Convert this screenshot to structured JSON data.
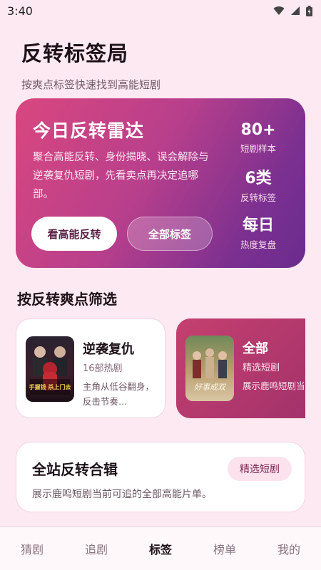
{
  "status_bar": {
    "time": "3:40"
  },
  "header": {
    "title": "反转标签局",
    "subtitle": "按爽点标签快速找到高能短剧"
  },
  "hero": {
    "title": "今日反转雷达",
    "description": "聚合高能反转、身份揭晓、误会解除与逆袭复仇短剧，先看卖点再决定追哪部。",
    "primary_button": "看高能反转",
    "secondary_button": "全部标签",
    "stats": [
      {
        "value": "80+",
        "label": "短剧样本"
      },
      {
        "value": "6类",
        "label": "反转标签"
      },
      {
        "value": "每日",
        "label": "热度复盘"
      }
    ]
  },
  "filter_section": {
    "title": "按反转爽点筛选"
  },
  "categories": [
    {
      "name": "逆袭复仇",
      "count": "16部热剧",
      "description": "主角从低谷翻身，反击节奏…",
      "poster_text": "手握钱 杀上门去"
    },
    {
      "name": "全部",
      "count": "精选短剧",
      "description": "展示鹿鸣短剧当前可追的全部…",
      "poster_text": "好事成双"
    }
  ],
  "collection": {
    "title": "全站反转合辑",
    "badge": "精选短剧",
    "description": "展示鹿鸣短剧当前可追的全部高能片单。"
  },
  "tabs": [
    {
      "label": "猜剧",
      "active": false
    },
    {
      "label": "追剧",
      "active": false
    },
    {
      "label": "标签",
      "active": true
    },
    {
      "label": "榜单",
      "active": false
    },
    {
      "label": "我的",
      "active": false
    }
  ]
}
